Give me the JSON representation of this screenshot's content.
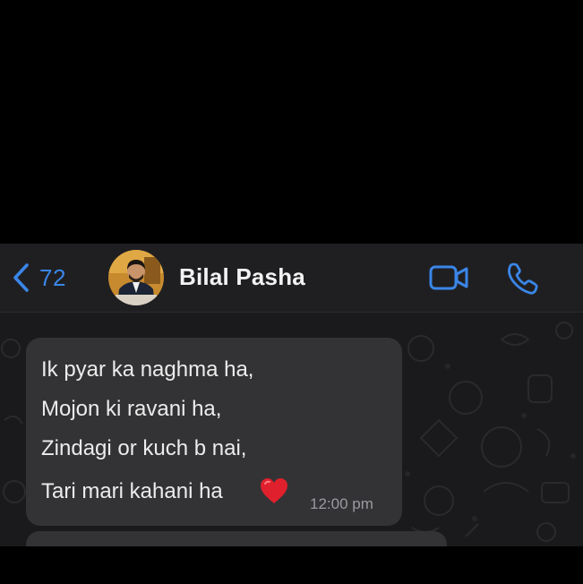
{
  "header": {
    "back_count": "72",
    "contact_name": "Bilal Pasha",
    "avatar_icon": "contact-avatar",
    "video_icon": "video-camera-icon",
    "call_icon": "phone-icon",
    "accent_color": "#3a86e8",
    "background_color": "#1f1f22"
  },
  "message": {
    "lines": [
      "Ik pyar ka naghma ha,",
      "Mojon ki ravani ha,",
      "Zindagi or kuch b nai,",
      "Tari mari kahani ha"
    ],
    "emoji_icon": "red-heart-icon",
    "time": "12:00 pm",
    "bubble_color": "#333336"
  },
  "chat_background_color": "#1a1a1c"
}
